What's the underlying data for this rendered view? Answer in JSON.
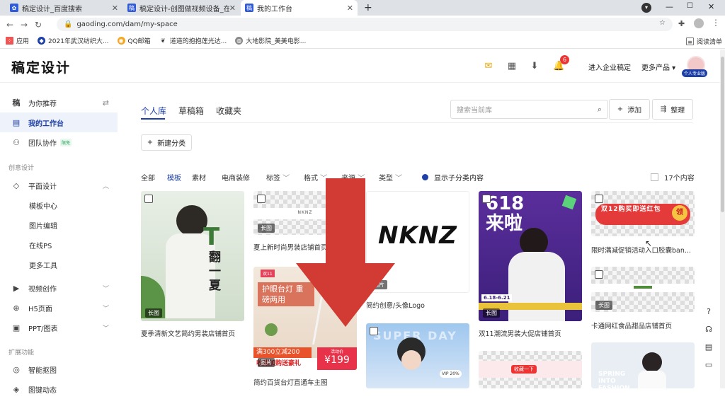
{
  "browser": {
    "tabs": [
      {
        "title": "稿定设计_百度搜索",
        "active": false
      },
      {
        "title": "稿定设计-创图做视频设备_在线设计...",
        "active": false
      },
      {
        "title": "我的工作台",
        "active": true
      }
    ],
    "new_tab": "+",
    "url": "gaoding.com/dam/my-space",
    "bookmarks": [
      "应用",
      "2021年武汉纺织大...",
      "QQ邮箱",
      "道道的抱抱莲光达...",
      "大地影院_美美电影..."
    ],
    "reading_list": "阅读清单",
    "colors": {
      "tab_bar": "#dee1e6"
    }
  },
  "header": {
    "logo": "稿定设计",
    "notification_count": "6",
    "enterprise_link": "进入企业稿定",
    "more_products": "更多产品",
    "avatar_badge": "个人专业版"
  },
  "sidebar": {
    "items": [
      {
        "label": "为你推荐",
        "icon": "gaoding-icon"
      },
      {
        "label": "我的工作台",
        "icon": "workspace-icon",
        "active": true
      },
      {
        "label": "团队协作",
        "icon": "team-icon",
        "badge": "限免"
      }
    ],
    "section_creative": "创意设计",
    "graphic": {
      "label": "平面设计",
      "subitems": [
        "模板中心",
        "图片编辑",
        "在线PS",
        "更多工具"
      ]
    },
    "more_items": [
      {
        "label": "视频创作",
        "icon": "video-icon"
      },
      {
        "label": "H5页面",
        "icon": "globe-icon"
      },
      {
        "label": "PPT/图表",
        "icon": "ppt-icon"
      }
    ],
    "section_ext": "扩展功能",
    "ext_items": [
      {
        "label": "智能抠图",
        "icon": "cutout-icon"
      },
      {
        "label": "图键动态",
        "icon": "motion-icon"
      }
    ],
    "colors": {
      "active_bg": "#eef2fb",
      "active_text": "#1d3fa6"
    }
  },
  "main": {
    "tabs": [
      "个人库",
      "草稿箱",
      "收藏夹"
    ],
    "search_placeholder": "搜索当前库",
    "add_label": "添加",
    "organize_label": "整理",
    "new_category": "新建分类",
    "filters": [
      "全部",
      "模板",
      "素材",
      "电商装修",
      "标签",
      "格式",
      "来源",
      "类型"
    ],
    "active_filter": "模板",
    "show_sub": "显示子分类内容",
    "count": "17个内容",
    "cards": [
      {
        "title": "夏季清新文艺简约男装店铺首页",
        "tag": "长图",
        "img_text": "T 翻 一夏"
      },
      {
        "title": "夏上新时尚男装店铺首页",
        "tag": "长图",
        "img_text": "NKNZ"
      },
      {
        "title": "简约百货台灯直通车主图",
        "tag": "图片",
        "img_text": "护眼台灯 重磅两用",
        "promo1": "满300立减200",
        "promo2": "收藏加购送豪礼",
        "price": "¥199",
        "price_label": "活动价"
      },
      {
        "title": "简约创意/头像Logo",
        "tag": "图片",
        "img_text": "NKNZ"
      },
      {
        "title": "",
        "tag": "",
        "img_text": "VIP 20%"
      },
      {
        "title": "双11潮流男装大促店铺首页",
        "tag": "长图",
        "img_text": "618 来啦",
        "date": "6.18-6.21"
      },
      {
        "title": "",
        "tag": "",
        "img_text": "收藏一下"
      },
      {
        "title": "限时满减促销活动入口胶囊ban...",
        "tag": "",
        "img_text": "双12购买即送红包",
        "badge": "领"
      },
      {
        "title": "卡通网红食品甜品店铺首页",
        "tag": "长图",
        "img_text": ""
      },
      {
        "title": "",
        "tag": "",
        "img_text": "SPRING INTO FASHION"
      }
    ]
  },
  "overlay": {
    "arrow_color": "#d23b34"
  },
  "floating_tools": [
    "help-icon",
    "headset-icon",
    "document-icon",
    "chat-icon"
  ]
}
